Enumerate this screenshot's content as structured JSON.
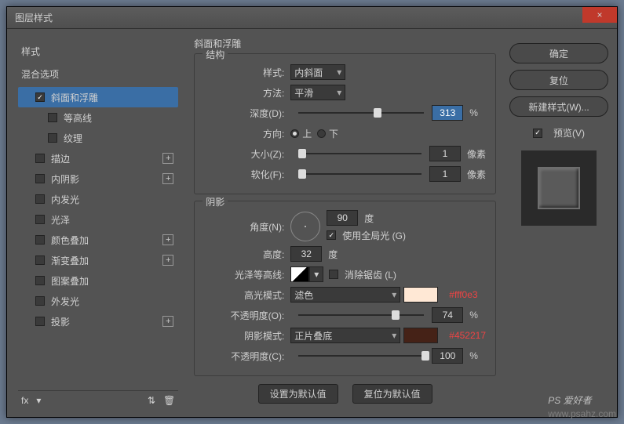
{
  "window": {
    "title": "图层样式",
    "close": "×"
  },
  "left": {
    "styles": "样式",
    "blend": "混合选项",
    "items": [
      {
        "label": "斜面和浮雕",
        "checked": true,
        "active": true,
        "plus": false,
        "sub": false
      },
      {
        "label": "等高线",
        "checked": false,
        "active": false,
        "plus": false,
        "sub": true
      },
      {
        "label": "纹理",
        "checked": false,
        "active": false,
        "plus": false,
        "sub": true
      },
      {
        "label": "描边",
        "checked": false,
        "active": false,
        "plus": true,
        "sub": false
      },
      {
        "label": "内阴影",
        "checked": false,
        "active": false,
        "plus": true,
        "sub": false
      },
      {
        "label": "内发光",
        "checked": false,
        "active": false,
        "plus": false,
        "sub": false
      },
      {
        "label": "光泽",
        "checked": false,
        "active": false,
        "plus": false,
        "sub": false
      },
      {
        "label": "颜色叠加",
        "checked": false,
        "active": false,
        "plus": true,
        "sub": false
      },
      {
        "label": "渐变叠加",
        "checked": false,
        "active": false,
        "plus": true,
        "sub": false
      },
      {
        "label": "图案叠加",
        "checked": false,
        "active": false,
        "plus": false,
        "sub": false
      },
      {
        "label": "外发光",
        "checked": false,
        "active": false,
        "plus": false,
        "sub": false
      },
      {
        "label": "投影",
        "checked": false,
        "active": false,
        "plus": true,
        "sub": false
      }
    ],
    "fx": "fx"
  },
  "mid": {
    "heading": "斜面和浮雕",
    "struct": {
      "legend": "结构",
      "style_label": "样式:",
      "style_value": "内斜面",
      "method_label": "方法:",
      "method_value": "平滑",
      "depth_label": "深度(D):",
      "depth_value": "313",
      "depth_unit": "%",
      "dir_label": "方向:",
      "up": "上",
      "down": "下",
      "size_label": "大小(Z):",
      "size_value": "1",
      "size_unit": "像素",
      "soft_label": "软化(F):",
      "soft_value": "1",
      "soft_unit": "像素"
    },
    "shade": {
      "legend": "阴影",
      "angle_label": "角度(N):",
      "angle_value": "90",
      "angle_unit": "度",
      "global_label": "使用全局光 (G)",
      "alt_label": "高度:",
      "alt_value": "32",
      "alt_unit": "度",
      "gloss_label": "光泽等高线:",
      "anti_label": "消除锯齿 (L)",
      "hi_mode_label": "高光模式:",
      "hi_mode_value": "滤色",
      "hi_hex": "#fff0e3",
      "hi_color": "#ffe8d5",
      "hi_op_label": "不透明度(O):",
      "hi_op_value": "74",
      "pct": "%",
      "sh_mode_label": "阴影模式:",
      "sh_mode_value": "正片叠底",
      "sh_hex": "#452217",
      "sh_color": "#452217",
      "sh_op_label": "不透明度(C):",
      "sh_op_value": "100"
    },
    "defaults": {
      "set": "设置为默认值",
      "reset": "复位为默认值"
    }
  },
  "right": {
    "ok": "确定",
    "cancel": "复位",
    "newstyle": "新建样式(W)...",
    "preview": "预览(V)"
  },
  "watermark": {
    "a": "PS 爱好者",
    "b": "www.psahz.com"
  }
}
